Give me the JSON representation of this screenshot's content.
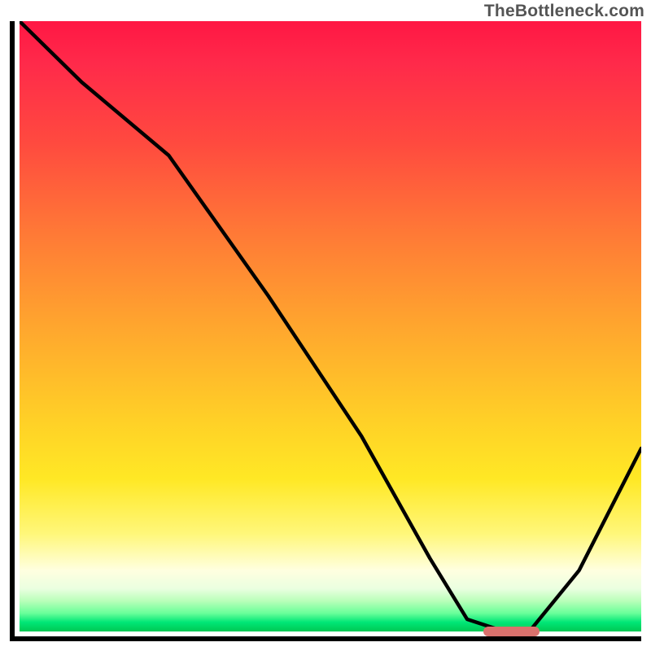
{
  "watermark": "TheBottleneck.com",
  "colors": {
    "gradient_top": "#ff1744",
    "gradient_mid": "#ffe825",
    "gradient_bottom": "#00c853",
    "curve": "#000000",
    "marker": "#d9716d",
    "axis": "#000000"
  },
  "chart_data": {
    "type": "line",
    "title": "",
    "xlabel": "",
    "ylabel": "",
    "xlim": [
      0,
      100
    ],
    "ylim": [
      0,
      100
    ],
    "series": [
      {
        "name": "bottleneck-curve",
        "x": [
          0,
          10,
          24,
          40,
          55,
          66,
          72,
          78,
          82,
          90,
          100
        ],
        "y": [
          100,
          90,
          78,
          55,
          32,
          12,
          2,
          0,
          0,
          10,
          30
        ]
      }
    ],
    "annotations": [
      {
        "name": "optimal-marker",
        "x_start": 74,
        "x_end": 83,
        "y": 0.8
      }
    ]
  }
}
